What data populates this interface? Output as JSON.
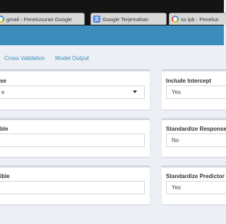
{
  "browser": {
    "tabs": [
      {
        "label": "gmail - Penelusuran Google",
        "icon": "google-icon"
      },
      {
        "label": "Google Terjemahan",
        "icon": "translate-icon"
      },
      {
        "label": "ss ipb - Penelus",
        "icon": "google-icon"
      }
    ]
  },
  "subnav": {
    "links": [
      "Cross Validation",
      "Model Output"
    ]
  },
  "form": {
    "left": [
      {
        "label": "se",
        "value": "e"
      },
      {
        "label": "ble",
        "value": ""
      },
      {
        "label": "ible",
        "value": ""
      }
    ],
    "right": [
      {
        "label": "Include Intercept",
        "value": "Yes"
      },
      {
        "label": "Standardize Response",
        "value": "No"
      },
      {
        "label": "Standardize Predictor",
        "value": "Yes"
      }
    ]
  },
  "colors": {
    "header": "#3c8dbc",
    "link": "#3c8dbc",
    "background": "#ecf0f5"
  }
}
